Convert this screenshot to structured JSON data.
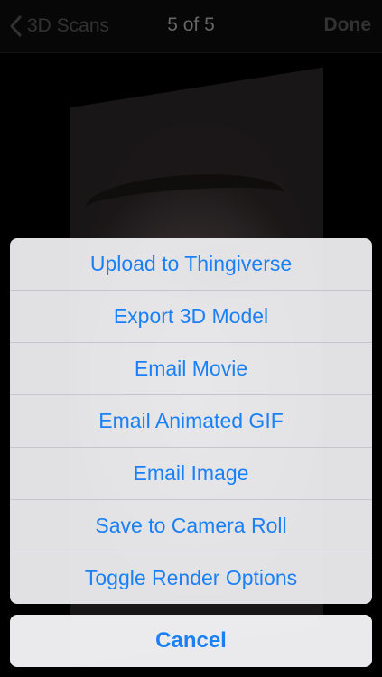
{
  "navbar": {
    "back_label": "3D Scans",
    "title": "5 of 5",
    "done_label": "Done"
  },
  "action_sheet": {
    "items": [
      {
        "label": "Upload to Thingiverse"
      },
      {
        "label": "Export 3D Model"
      },
      {
        "label": "Email Movie"
      },
      {
        "label": "Email Animated GIF"
      },
      {
        "label": "Email Image"
      },
      {
        "label": "Save to Camera Roll"
      },
      {
        "label": "Toggle Render Options"
      }
    ],
    "cancel_label": "Cancel"
  },
  "icons": {
    "back": "chevron-left-icon"
  },
  "colors": {
    "accent": "#1a80f5",
    "sheet_background": "#f2f2f4",
    "navbar_disabled_text": "#4d4d4d"
  }
}
